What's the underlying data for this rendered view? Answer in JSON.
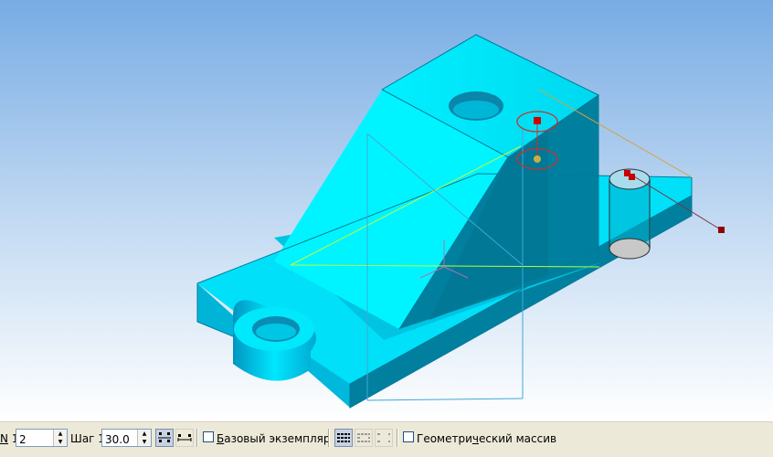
{
  "colors": {
    "viewport_top": "#7aaee6",
    "viewport_bottom": "#ffffff",
    "model_light": "#00ffff",
    "model_mid": "#00c8e0",
    "model_dark": "#0086a8",
    "selection": "#c80000",
    "toolbar_bg": "#ece9d8"
  },
  "toolbar": {
    "count_label_prefix": "N",
    "count_label_suffix": "1",
    "count_value": "2",
    "step_label": "Шаг 1",
    "step_value": "30.0",
    "base_instance": {
      "label_accel": "Б",
      "label_rest": "азовый экземпляр",
      "checked": false
    },
    "geometric_array": {
      "label_before": "Геометри",
      "label_accel": "ч",
      "label_after": "еский массив",
      "checked": false
    }
  }
}
